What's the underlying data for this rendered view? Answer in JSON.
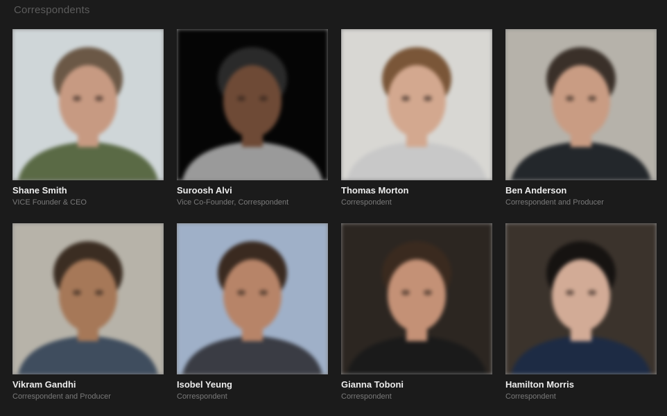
{
  "section": {
    "title": "Correspondents"
  },
  "people": [
    {
      "name": "Shane Smith",
      "role": "VICE Founder & CEO",
      "bg": "#cfd6d8",
      "hair": "#6b5846",
      "skin": "#c79a82",
      "shirt": "#5a6a45"
    },
    {
      "name": "Suroosh Alvi",
      "role": "Vice Co-Founder, Correspondent",
      "bg": "#050505",
      "hair": "#2a2a2a",
      "skin": "#6e4a36",
      "shirt": "#9a9a9a"
    },
    {
      "name": "Thomas Morton",
      "role": "Correspondent",
      "bg": "#d8d7d3",
      "hair": "#7a5638",
      "skin": "#d3a88f",
      "shirt": "#c8c8c8"
    },
    {
      "name": "Ben Anderson",
      "role": "Correspondent and Producer",
      "bg": "#b6b2aa",
      "hair": "#3a3029",
      "skin": "#c99c83",
      "shirt": "#23272b"
    },
    {
      "name": "Vikram Gandhi",
      "role": "Correspondent and Producer",
      "bg": "#b7b3a9",
      "hair": "#3b2d22",
      "skin": "#a67858",
      "shirt": "#3f4d5e"
    },
    {
      "name": "Isobel Yeung",
      "role": "Correspondent",
      "bg": "#9fb0c8",
      "hair": "#3a2a20",
      "skin": "#b78468",
      "shirt": "#3a3c44"
    },
    {
      "name": "Gianna Toboni",
      "role": "Correspondent",
      "bg": "#2c2621",
      "hair": "#3a2a1f",
      "skin": "#c49176",
      "shirt": "#1a1a1a"
    },
    {
      "name": "Hamilton Morris",
      "role": "Correspondent",
      "bg": "#3b332c",
      "hair": "#161311",
      "skin": "#d2ab96",
      "shirt": "#1d2b44"
    }
  ]
}
